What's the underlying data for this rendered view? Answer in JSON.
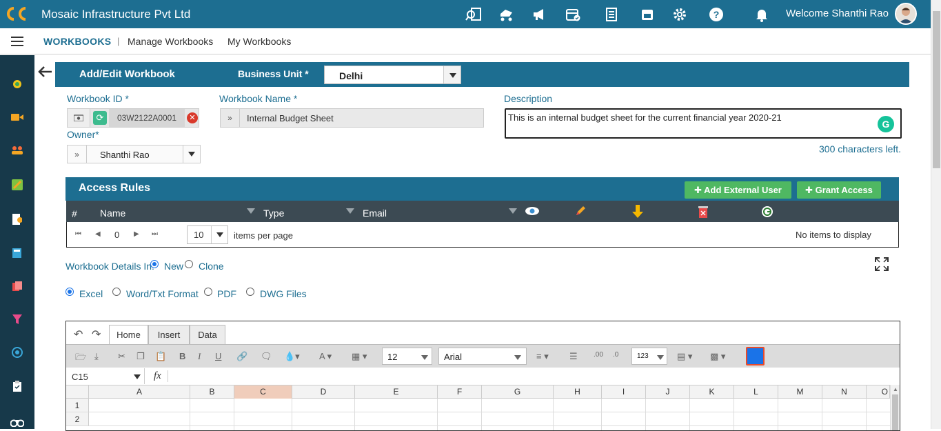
{
  "app": {
    "company": "Mosaic Infrastructure Pvt Ltd",
    "welcome": "Welcome Shanthi Rao",
    "top_icons": [
      "search-report-icon",
      "truck-icon",
      "megaphone-icon",
      "calendar-check-icon",
      "list-icon",
      "calendar-icon",
      "gear-icon",
      "help-icon",
      "bell-icon"
    ]
  },
  "nav": {
    "section": "WORKBOOKS",
    "separator": "|",
    "manage": "Manage Workbooks",
    "my": "My Workbooks"
  },
  "form": {
    "title": "Add/Edit Workbook",
    "business_unit_label": "Business Unit *",
    "business_unit_value": "Delhi",
    "workbook_id_label": "Workbook ID *",
    "workbook_id_value": "03W2122A0001",
    "workbook_name_label": "Workbook Name *",
    "workbook_name_value": "Internal Budget Sheet",
    "description_label": "Description",
    "description_value": "This is an internal budget sheet for the current financial year 2020-21",
    "chars_left": "300 characters left.",
    "owner_label": "Owner*",
    "owner_value": "Shanthi Rao"
  },
  "access_rules": {
    "title": "Access Rules",
    "add_external_user": "Add External User",
    "grant_access": "Grant Access",
    "columns": [
      "#",
      "Name",
      "Type",
      "Email"
    ],
    "page_number": "0",
    "page_size": "10",
    "items_per_page": "items per page",
    "empty_text": "No items to display"
  },
  "details": {
    "label": "Workbook Details In:",
    "new": "New",
    "clone": "Clone",
    "formats": [
      "Excel",
      "Word/Txt Format",
      "PDF",
      "DWG Files"
    ],
    "selected_mode": "New",
    "selected_format": "Excel"
  },
  "spreadsheet": {
    "tabs": [
      "Home",
      "Insert",
      "Data"
    ],
    "active_tab": "Home",
    "font_size": "12",
    "font_name": "Arial",
    "number_format": "123",
    "cell_ref": "C15",
    "fx": "fx",
    "columns": [
      "A",
      "B",
      "C",
      "D",
      "E",
      "F",
      "G",
      "H",
      "I",
      "J",
      "K",
      "L",
      "M",
      "N",
      "O"
    ],
    "selected_column": "C",
    "rows": [
      "1",
      "2"
    ]
  },
  "colors": {
    "header_blue": "#1d6e91",
    "sidebar": "#17394a",
    "table_header": "#3c4a53",
    "button_green": "#4fb862"
  }
}
